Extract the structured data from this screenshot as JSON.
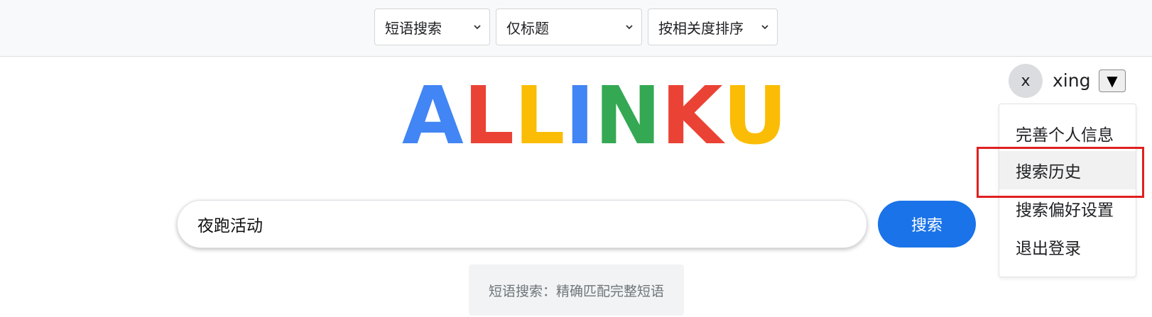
{
  "toolbar": {
    "search_mode": "短语搜索",
    "search_scope": "仅标题",
    "sort_order": "按相关度排序"
  },
  "logo": {
    "letters": [
      "A",
      "L",
      "L",
      "I",
      "N",
      "K",
      "U"
    ],
    "colors": [
      "#4285F4",
      "#EA4335",
      "#FBBC05",
      "#4285F4",
      "#34A853",
      "#EA4335",
      "#FBBC05"
    ]
  },
  "search": {
    "query": "夜跑活动",
    "button_label": "搜索",
    "hint": "短语搜索：精确匹配完整短语"
  },
  "user": {
    "avatar_initial": "x",
    "name": "xing",
    "toggle_symbol": "▼",
    "menu_items": [
      "完善个人信息",
      "搜索历史",
      "搜索偏好设置",
      "退出登录"
    ],
    "highlighted_item": "搜索历史"
  },
  "colors": {
    "primary": "#1a73e8",
    "highlight_box": "#e02020"
  }
}
